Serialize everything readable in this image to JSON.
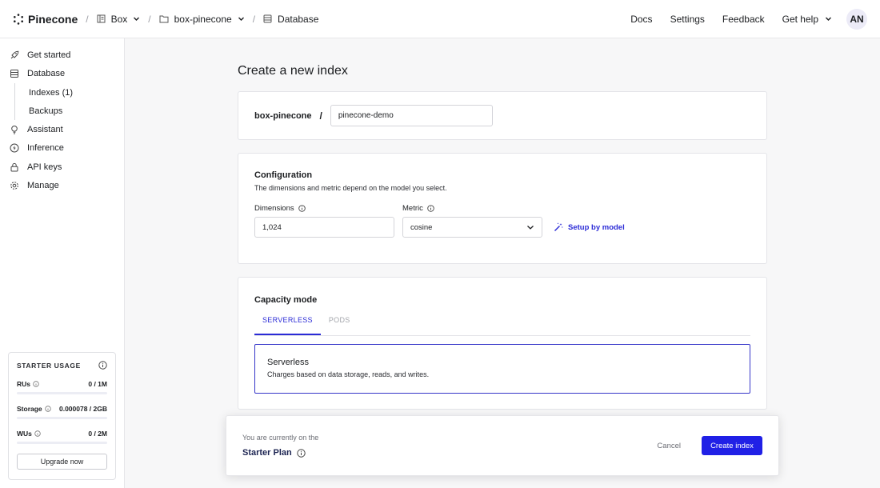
{
  "topbar": {
    "brand": "Pinecone",
    "breadcrumb": [
      {
        "label": "Box",
        "icon": "building-icon"
      },
      {
        "label": "box-pinecone",
        "icon": "folder-icon"
      },
      {
        "label": "Database",
        "icon": "database-icon"
      }
    ],
    "links": {
      "docs": "Docs",
      "settings": "Settings",
      "feedback": "Feedback",
      "help": "Get help"
    },
    "avatar": "AN"
  },
  "sidebar": {
    "items": [
      {
        "label": "Get started",
        "icon": "rocket-icon"
      },
      {
        "label": "Database",
        "icon": "database-icon"
      },
      {
        "label": "Assistant",
        "icon": "lightbulb-icon"
      },
      {
        "label": "Inference",
        "icon": "bolt-icon"
      },
      {
        "label": "API keys",
        "icon": "lock-icon"
      },
      {
        "label": "Manage",
        "icon": "gear-icon"
      }
    ],
    "database_sub": [
      {
        "label": "Indexes (1)"
      },
      {
        "label": "Backups"
      }
    ],
    "usage": {
      "title": "STARTER USAGE",
      "rows": [
        {
          "label": "RUs",
          "value": "0 / 1M",
          "fraction": 0
        },
        {
          "label": "Storage",
          "value": "0.000078 / 2GB",
          "fraction": 0.0001
        },
        {
          "label": "WUs",
          "value": "0 / 2M",
          "fraction": 0
        }
      ],
      "upgrade": "Upgrade now"
    }
  },
  "main": {
    "title": "Create a new index",
    "project": "box-pinecone",
    "separator": "/",
    "index_name": "pinecone-demo",
    "config": {
      "title": "Configuration",
      "subtitle": "The dimensions and metric depend on the model you select.",
      "dimensions_label": "Dimensions",
      "dimensions_value": "1,024",
      "metric_label": "Metric",
      "metric_value": "cosine",
      "setup_link": "Setup by model"
    },
    "capacity": {
      "title": "Capacity mode",
      "tabs": [
        "SERVERLESS",
        "PODS"
      ],
      "option_title": "Serverless",
      "option_desc": "Charges based on data storage, reads, and writes."
    }
  },
  "footer": {
    "note": "You are currently on the",
    "plan": "Starter Plan",
    "cancel": "Cancel",
    "create": "Create index"
  },
  "colors": {
    "accent": "#2020e6",
    "link": "#2b2bd6",
    "border": "#e3e4e8"
  }
}
